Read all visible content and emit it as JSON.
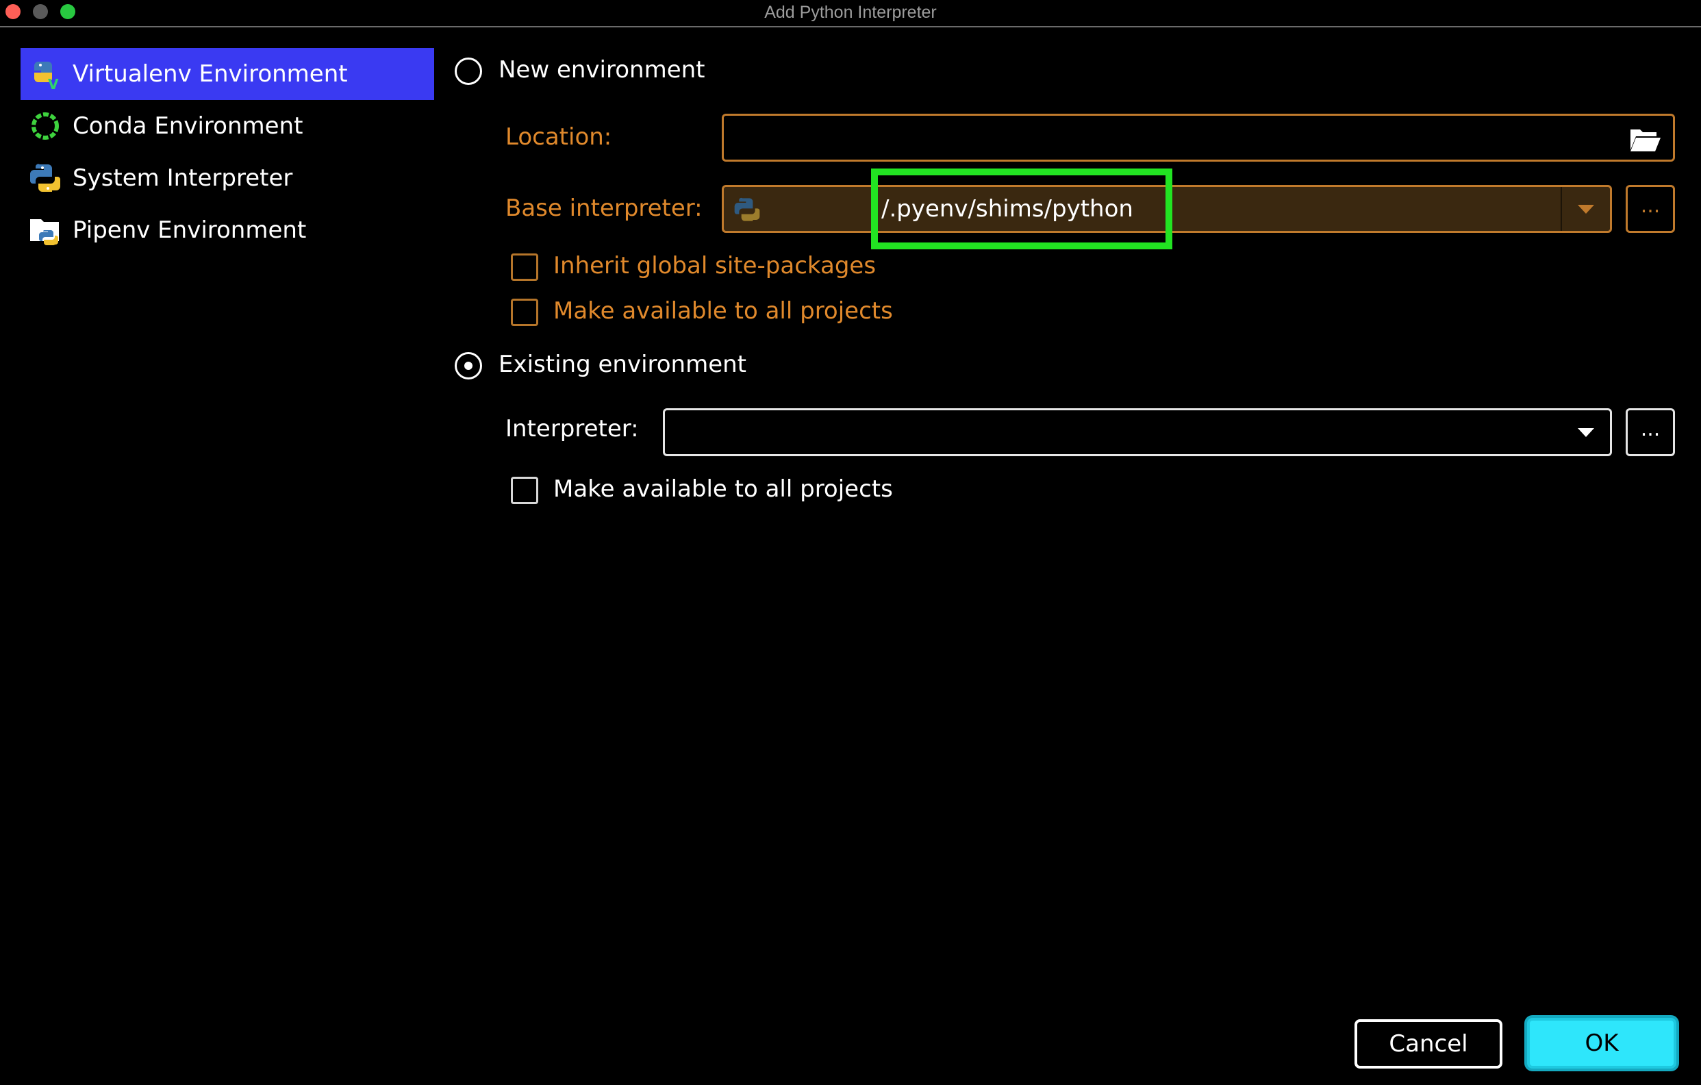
{
  "window": {
    "title": "Add Python Interpreter"
  },
  "sidebar": {
    "items": [
      {
        "label": "Virtualenv Environment",
        "icon": "virtualenv-icon",
        "selected": true
      },
      {
        "label": "Conda Environment",
        "icon": "conda-icon",
        "selected": false
      },
      {
        "label": "System Interpreter",
        "icon": "python-icon",
        "selected": false
      },
      {
        "label": "Pipenv Environment",
        "icon": "pipenv-icon",
        "selected": false
      }
    ]
  },
  "new_env": {
    "radio_label": "New environment",
    "selected": false,
    "location_label": "Location:",
    "location_value": "",
    "base_interpreter_label": "Base interpreter:",
    "base_interpreter_value": "/.pyenv/shims/python",
    "inherit_label": "Inherit global site-packages",
    "inherit_checked": false,
    "make_available_label": "Make available to all projects",
    "make_available_checked": false,
    "browse_label": "..."
  },
  "existing_env": {
    "radio_label": "Existing environment",
    "selected": true,
    "interpreter_label": "Interpreter:",
    "interpreter_value": "",
    "make_available_label": "Make available to all projects",
    "make_available_checked": false,
    "browse_label": "..."
  },
  "buttons": {
    "cancel": "Cancel",
    "ok": "OK"
  },
  "colors": {
    "selected_bg": "#3a3af2",
    "disabled_label": "#e0892c",
    "highlight": "#22e322",
    "ok_button": "#2ee6fb"
  }
}
